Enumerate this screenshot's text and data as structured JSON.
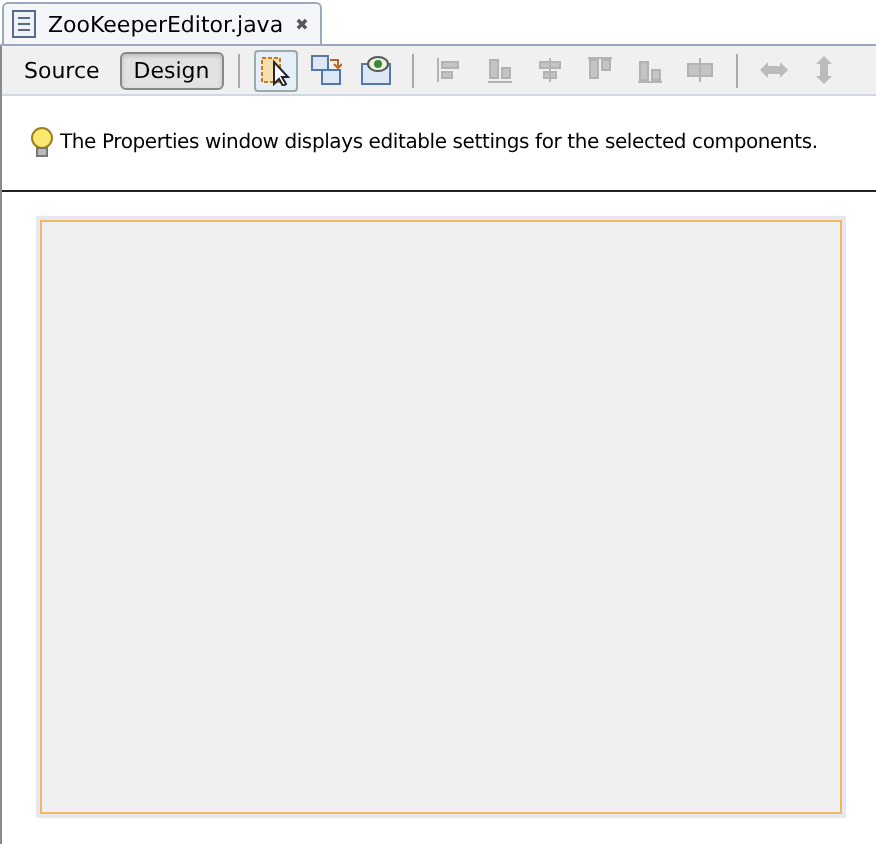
{
  "tab": {
    "title": "ZooKeeperEditor.java",
    "close": "✖"
  },
  "views": [
    {
      "label": "Source",
      "selected": false
    },
    {
      "label": "Design",
      "selected": true
    }
  ],
  "mode_tools": [
    {
      "kind": "selection",
      "selected": true
    },
    {
      "kind": "connection",
      "selected": false
    },
    {
      "kind": "preview",
      "selected": false
    }
  ],
  "align_tools": [
    {
      "kind": "align",
      "disabled": true
    },
    {
      "kind": "align",
      "disabled": true
    },
    {
      "kind": "align",
      "disabled": true
    },
    {
      "kind": "align",
      "disabled": true
    },
    {
      "kind": "align",
      "disabled": true
    },
    {
      "kind": "align",
      "disabled": true
    }
  ],
  "resize_tools": [
    {
      "kind": "horizontal",
      "disabled": true
    },
    {
      "kind": "vertical",
      "disabled": true
    }
  ],
  "hint": "The Properties window displays editable settings for the selected components."
}
